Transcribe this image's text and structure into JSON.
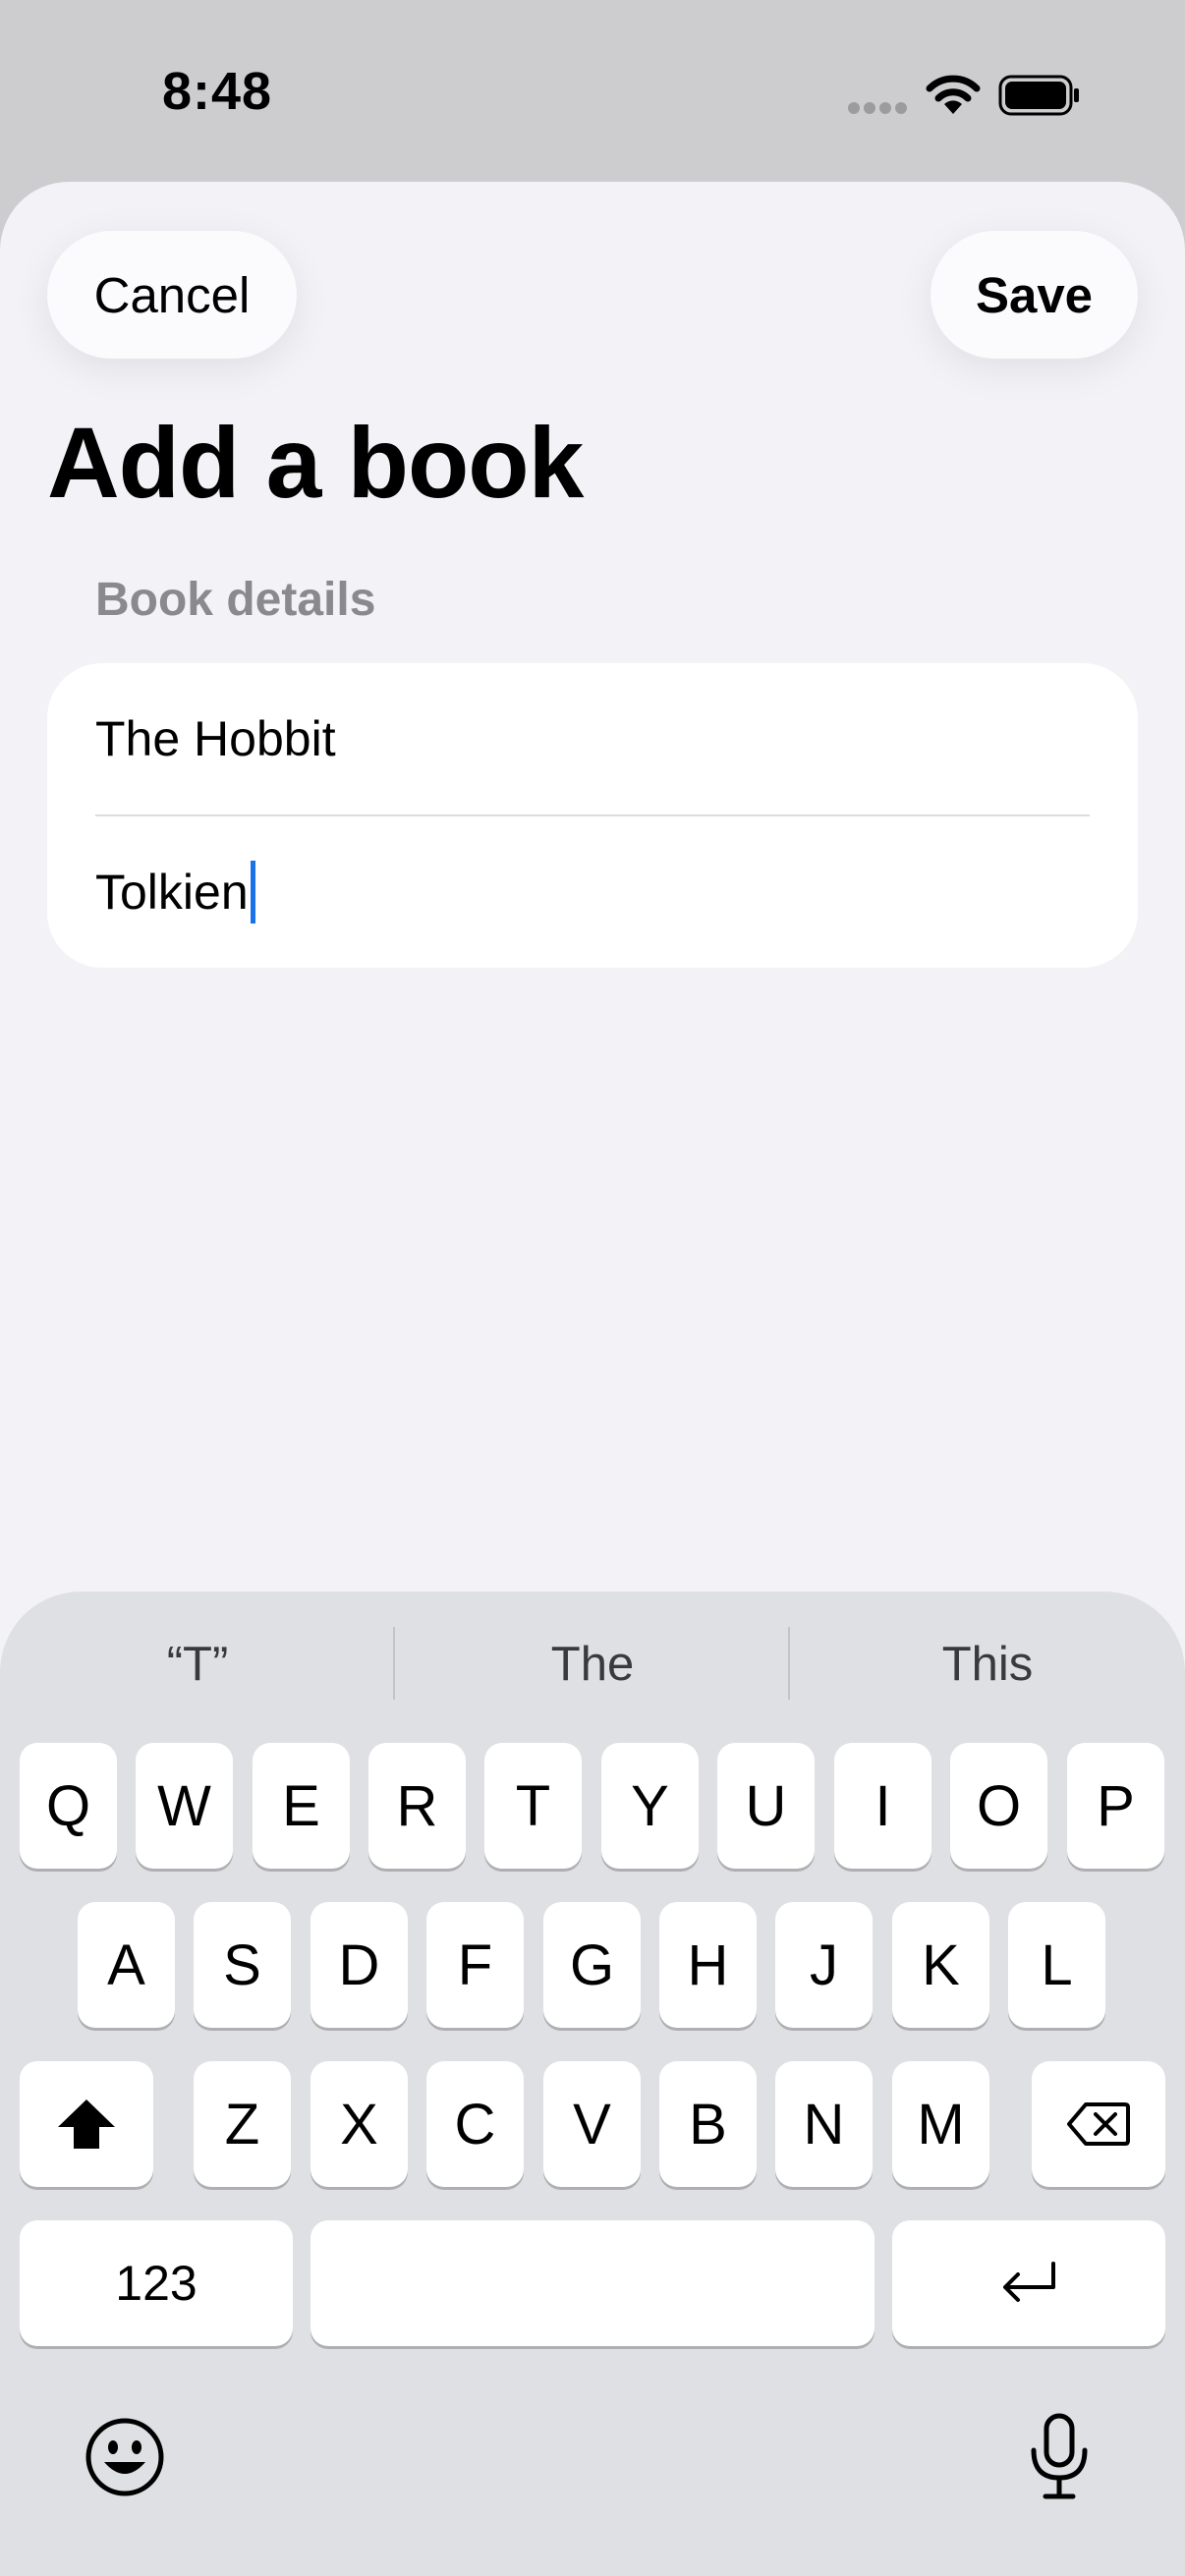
{
  "status_bar": {
    "time": "8:48"
  },
  "navigation": {
    "cancel_label": "Cancel",
    "save_label": "Save"
  },
  "page": {
    "title": "Add a book",
    "section_header": "Book details"
  },
  "form": {
    "title_value": "The Hobbit",
    "author_value": "Tolkien"
  },
  "keyboard": {
    "suggestions": [
      "“T”",
      "The",
      "This"
    ],
    "rows": [
      [
        "Q",
        "W",
        "E",
        "R",
        "T",
        "Y",
        "U",
        "I",
        "O",
        "P"
      ],
      [
        "A",
        "S",
        "D",
        "F",
        "G",
        "H",
        "J",
        "K",
        "L"
      ],
      [
        "Z",
        "X",
        "C",
        "V",
        "B",
        "N",
        "M"
      ]
    ],
    "numbers_label": "123",
    "icons": {
      "shift": "shift-icon",
      "delete": "delete-icon",
      "return": "return-icon",
      "emoji": "emoji-icon",
      "mic": "microphone-icon"
    }
  }
}
